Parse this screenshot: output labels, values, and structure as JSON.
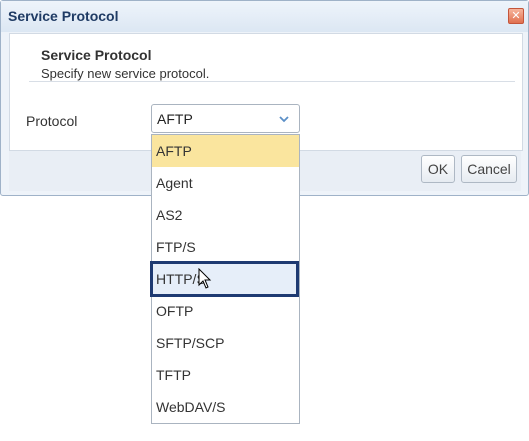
{
  "dialog": {
    "title": "Service Protocol",
    "close_icon": "close-icon",
    "header_title": "Service Protocol",
    "header_subtitle": "Specify new service protocol.",
    "protocol_label": "Protocol",
    "ok_label": "OK",
    "cancel_label": "Cancel"
  },
  "select": {
    "value": "AFTP",
    "arrow_icon": "chevron-down-icon",
    "options": [
      "AFTP",
      "Agent",
      "AS2",
      "FTP/S",
      "HTTP/S",
      "OFTP",
      "SFTP/SCP",
      "TFTP",
      "WebDAV/S"
    ],
    "selected_index": 0,
    "hovered_index": 4
  },
  "colors": {
    "selected_bg": "#fae59e",
    "hover_border": "#1e3a72",
    "title_color": "#1f3b64"
  }
}
